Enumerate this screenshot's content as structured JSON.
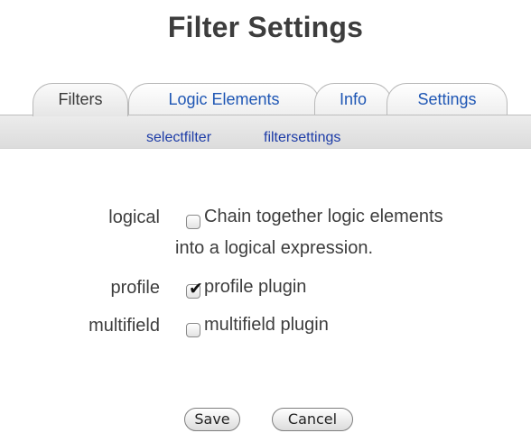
{
  "page": {
    "title": "Filter Settings"
  },
  "tabs": [
    {
      "label": "Filters",
      "active": true
    },
    {
      "label": "Logic Elements",
      "active": false
    },
    {
      "label": "Info",
      "active": false
    },
    {
      "label": "Settings",
      "active": false
    }
  ],
  "subnav": {
    "links": [
      "selectfilter",
      "filtersettings"
    ]
  },
  "form": {
    "rows": [
      {
        "label": "logical",
        "checked": false,
        "text_line1": "Chain together logic elements",
        "text_line2": "into a logical expression."
      },
      {
        "label": "profile",
        "checked": true,
        "text": "profile plugin"
      },
      {
        "label": "multifield",
        "checked": false,
        "text": "multifield plugin"
      }
    ]
  },
  "buttons": {
    "save": "Save",
    "cancel": "Cancel"
  },
  "colors": {
    "link": "#1d3ca7",
    "tab_link": "#1e56b4",
    "text": "#3d3d3d"
  }
}
